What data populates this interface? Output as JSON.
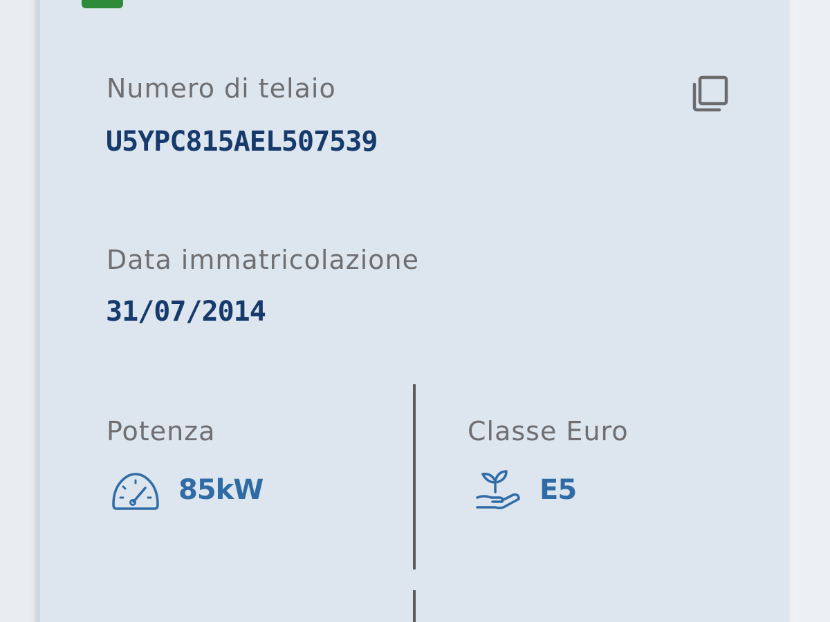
{
  "vehicle": {
    "vin_label": "Numero di telaio",
    "vin_value": "U5YPC815AEL507539",
    "registration_label": "Data immatricolazione",
    "registration_value": "31/07/2014"
  },
  "stats": {
    "power_label": "Potenza",
    "power_value": "85kW",
    "euro_class_label": "Classe Euro",
    "euro_class_value": "E5"
  },
  "icons": {
    "copy": "copy-icon",
    "power": "speedometer-icon",
    "euro_class": "plant-hand-icon"
  },
  "colors": {
    "card_bg": "#dde5ef",
    "label": "#6f6f72",
    "value": "#163a6b",
    "accent": "#2f6ca6",
    "badge": "#2e8b3a"
  }
}
